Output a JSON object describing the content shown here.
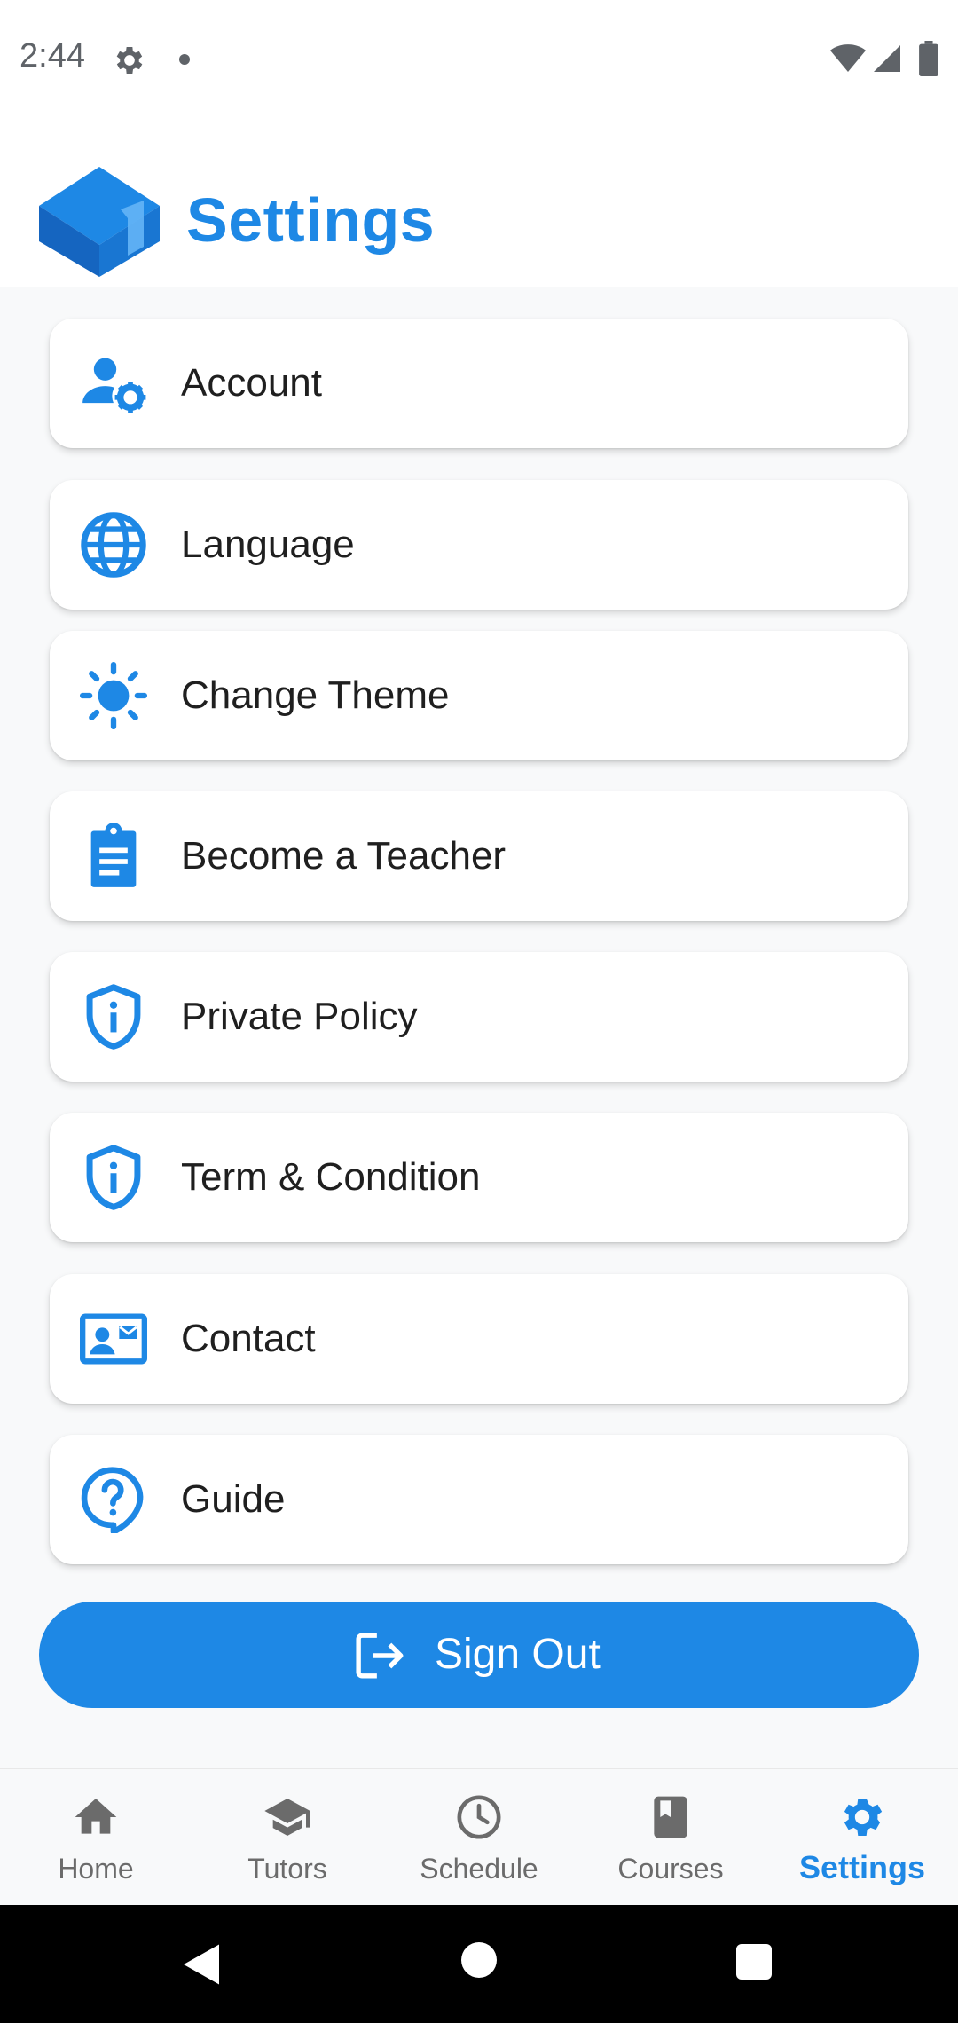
{
  "status": {
    "time": "2:44"
  },
  "header": {
    "title": "Settings"
  },
  "menu": [
    {
      "label": "Account",
      "icon": "user-gear-icon"
    },
    {
      "label": "Language",
      "icon": "globe-icon"
    },
    {
      "label": "Change Theme",
      "icon": "sun-icon"
    },
    {
      "label": "Become a Teacher",
      "icon": "clipboard-icon"
    },
    {
      "label": "Private Policy",
      "icon": "shield-info-icon"
    },
    {
      "label": "Term & Condition",
      "icon": "shield-info-icon"
    },
    {
      "label": "Contact",
      "icon": "contact-card-icon"
    },
    {
      "label": "Guide",
      "icon": "help-bubble-icon"
    }
  ],
  "signout": {
    "label": "Sign Out",
    "icon": "logout-icon"
  },
  "nav": [
    {
      "label": "Home",
      "icon": "home-icon",
      "active": false
    },
    {
      "label": "Tutors",
      "icon": "graduation-cap-icon",
      "active": false
    },
    {
      "label": "Schedule",
      "icon": "clock-icon",
      "active": false
    },
    {
      "label": "Courses",
      "icon": "book-icon",
      "active": false
    },
    {
      "label": "Settings",
      "icon": "gear-icon",
      "active": true
    }
  ],
  "colors": {
    "accent": "#1e88e5",
    "background": "#f8f9fa",
    "inactive_nav": "#6b6b6b"
  }
}
